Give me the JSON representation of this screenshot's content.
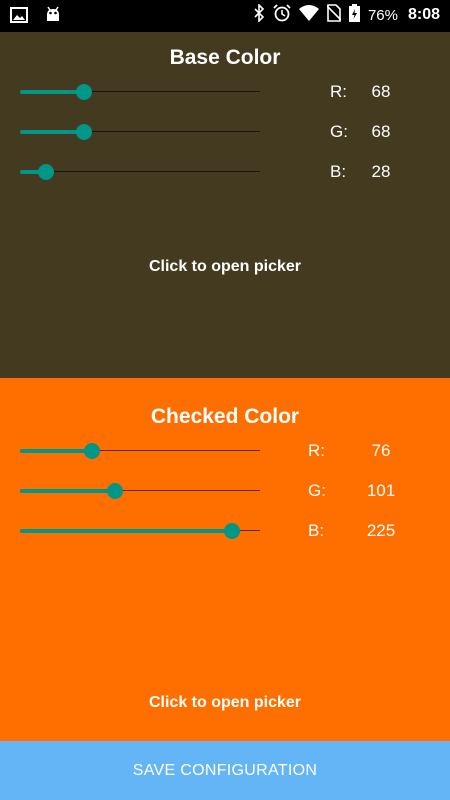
{
  "status_bar": {
    "battery_percent": "76%",
    "time": "8:08",
    "icons": [
      "image-icon",
      "android-debug-icon",
      "bluetooth-icon",
      "alarm-icon",
      "wifi-icon",
      "no-sim-icon",
      "battery-charging-icon"
    ]
  },
  "base_color": {
    "title": "Base Color",
    "swatch_hex": "#443A20",
    "channels": [
      {
        "label": "R:",
        "value": "68",
        "level": 68
      },
      {
        "label": "G:",
        "value": "68",
        "level": 68
      },
      {
        "label": "B:",
        "value": "28",
        "level": 28
      }
    ],
    "picker_label": "Click to open picker"
  },
  "checked_color": {
    "title": "Checked Color",
    "swatch_hex": "#FF6F00",
    "channels": [
      {
        "label": "R:",
        "value": "76",
        "level": 76
      },
      {
        "label": "G:",
        "value": "101",
        "level": 101
      },
      {
        "label": "B:",
        "value": "225",
        "level": 225
      }
    ],
    "picker_label": "Click to open picker"
  },
  "slider": {
    "max": 255,
    "accent_color": "#009688"
  },
  "save_button": {
    "label": "SAVE CONFIGURATION",
    "color": "#64B5F6"
  }
}
